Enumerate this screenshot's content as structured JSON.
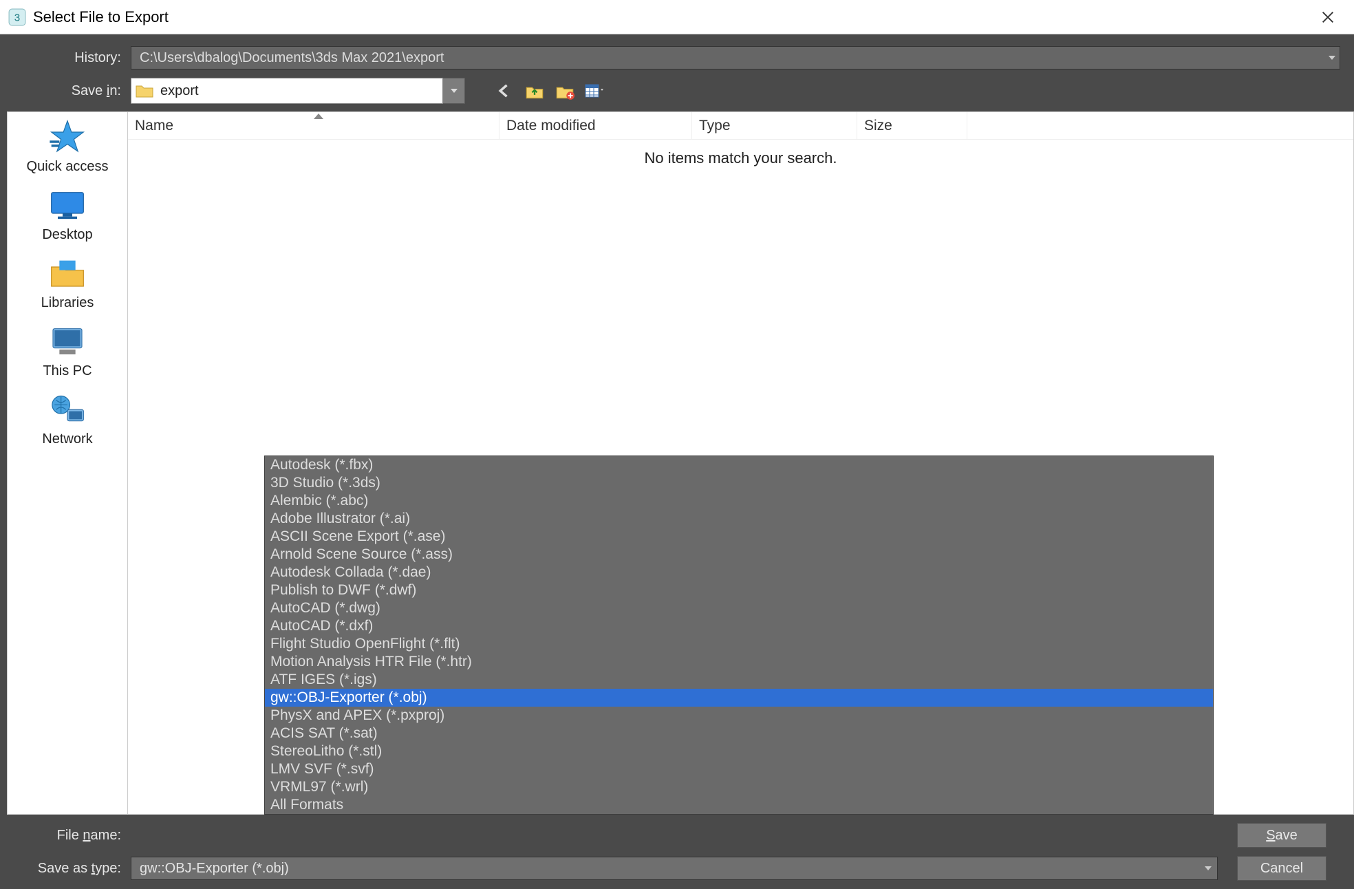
{
  "title": "Select File to Export",
  "history": {
    "label": "History:",
    "value": "C:\\Users\\dbalog\\Documents\\3ds Max 2021\\export"
  },
  "save_in": {
    "label": "Save in:",
    "value": "export"
  },
  "columns": {
    "name": "Name",
    "date": "Date modified",
    "type": "Type",
    "size": "Size"
  },
  "empty_message": "No items match your search.",
  "places": {
    "quick_access": "Quick access",
    "desktop": "Desktop",
    "libraries": "Libraries",
    "this_pc": "This PC",
    "network": "Network"
  },
  "file_name": {
    "label": "File name:"
  },
  "save_as_type": {
    "label": "Save as type:",
    "value": "gw::OBJ-Exporter (*.obj)"
  },
  "buttons": {
    "save": "Save",
    "cancel": "Cancel"
  },
  "type_options": [
    "Autodesk (*.fbx)",
    "3D Studio (*.3ds)",
    "Alembic (*.abc)",
    "Adobe Illustrator (*.ai)",
    "ASCII Scene Export (*.ase)",
    "Arnold Scene Source (*.ass)",
    "Autodesk Collada (*.dae)",
    "Publish to DWF (*.dwf)",
    "AutoCAD (*.dwg)",
    "AutoCAD (*.dxf)",
    "Flight Studio OpenFlight (*.flt)",
    "Motion Analysis HTR File (*.htr)",
    "ATF IGES (*.igs)",
    "gw::OBJ-Exporter (*.obj)",
    "PhysX and APEX (*.pxproj)",
    "ACIS SAT (*.sat)",
    "StereoLitho (*.stl)",
    "LMV SVF (*.svf)",
    "VRML97 (*.wrl)",
    "All Formats"
  ],
  "type_selected_index": 13
}
